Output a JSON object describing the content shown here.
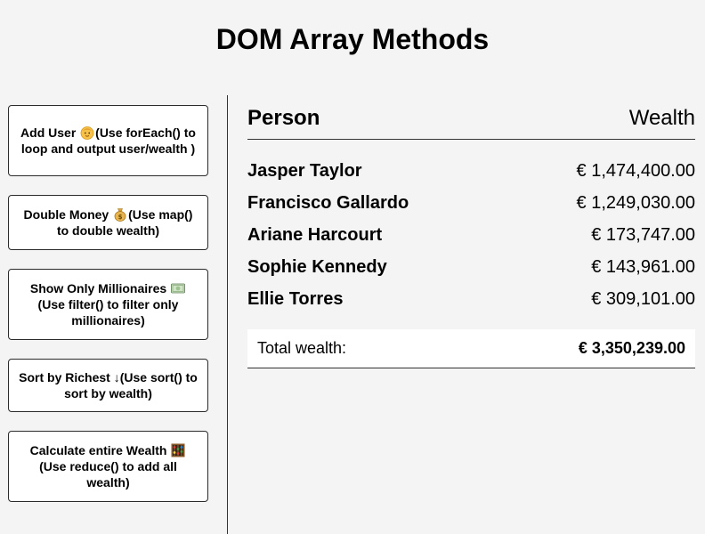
{
  "page": {
    "title": "DOM Array Methods"
  },
  "sidebar": {
    "buttons": [
      {
        "text_before": "Add User ",
        "icon": "baby-face-icon",
        "text_after": "(Use forEach() to loop and output user/wealth )"
      },
      {
        "text_before": "Double Money ",
        "icon": "money-bag-icon",
        "text_after": "(Use map() to double wealth)"
      },
      {
        "text_before": "Show Only Millionaires ",
        "icon": "money-bill-icon",
        "text_after": "(Use filter() to filter only millionaires)"
      },
      {
        "text_before": "Sort by Richest ",
        "icon": "down-arrow-icon",
        "glyph": "↓",
        "text_after": "(Use sort() to sort by wealth)"
      },
      {
        "text_before": "Calculate entire Wealth ",
        "icon": "abacus-icon",
        "text_after": "(Use reduce() to add all wealth)"
      }
    ]
  },
  "table": {
    "header_person": "Person",
    "header_wealth": "Wealth",
    "rows": [
      {
        "name": "Jasper Taylor",
        "wealth": "€ 1,474,400.00"
      },
      {
        "name": "Francisco Gallardo",
        "wealth": "€ 1,249,030.00"
      },
      {
        "name": "Ariane Harcourt",
        "wealth": "€ 173,747.00"
      },
      {
        "name": "Sophie Kennedy",
        "wealth": "€ 143,961.00"
      },
      {
        "name": "Ellie Torres",
        "wealth": "€ 309,101.00"
      }
    ],
    "total_label": "Total wealth:",
    "total_value": "€ 3,350,239.00"
  },
  "colors": {
    "background": "#f4f4f4",
    "card": "#ffffff",
    "border": "#2b2b2b"
  }
}
